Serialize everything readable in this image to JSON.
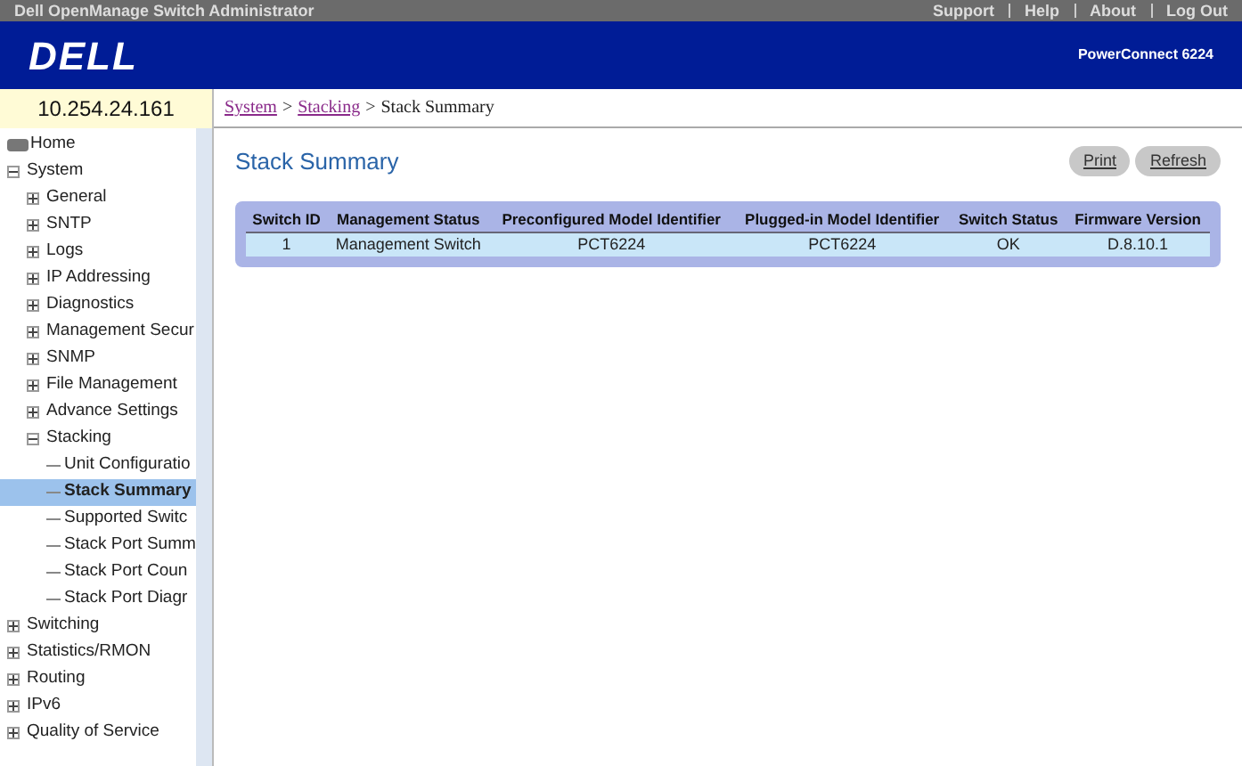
{
  "top_bar": {
    "title": "Dell OpenManage Switch Administrator",
    "links": [
      "Support",
      "Help",
      "About",
      "Log Out"
    ]
  },
  "header": {
    "logo": "DELL",
    "product": "PowerConnect 6224"
  },
  "ip_address": "10.254.24.161",
  "breadcrumb": {
    "separator": ">",
    "items": [
      {
        "label": "System",
        "kind": "link"
      },
      {
        "label": "Stacking",
        "kind": "link"
      },
      {
        "label": "Stack Summary",
        "kind": "current"
      }
    ]
  },
  "sidebar": {
    "items": [
      {
        "label": "Home",
        "kind": "home",
        "selected": false
      },
      {
        "label": "System",
        "kind": "folder",
        "expanded": true,
        "selected": false,
        "children": [
          {
            "label": "General",
            "kind": "folder",
            "expanded": false,
            "selected": false
          },
          {
            "label": "SNTP",
            "kind": "folder",
            "expanded": false,
            "selected": false
          },
          {
            "label": "Logs",
            "kind": "folder",
            "expanded": false,
            "selected": false
          },
          {
            "label": "IP Addressing",
            "kind": "folder",
            "expanded": false,
            "selected": false
          },
          {
            "label": "Diagnostics",
            "kind": "folder",
            "expanded": false,
            "selected": false
          },
          {
            "label": "Management Secur",
            "kind": "folder",
            "expanded": false,
            "selected": false
          },
          {
            "label": "SNMP",
            "kind": "folder",
            "expanded": false,
            "selected": false
          },
          {
            "label": "File Management",
            "kind": "folder",
            "expanded": false,
            "selected": false
          },
          {
            "label": "Advance Settings",
            "kind": "folder",
            "expanded": false,
            "selected": false
          },
          {
            "label": "Stacking",
            "kind": "folder",
            "expanded": true,
            "selected": false,
            "children": [
              {
                "label": "Unit Configuratio",
                "kind": "leaf",
                "selected": false
              },
              {
                "label": "Stack Summary",
                "kind": "leaf",
                "selected": true
              },
              {
                "label": "Supported Switc",
                "kind": "leaf",
                "selected": false
              },
              {
                "label": "Stack Port Summ",
                "kind": "leaf",
                "selected": false
              },
              {
                "label": "Stack Port Coun",
                "kind": "leaf",
                "selected": false
              },
              {
                "label": "Stack Port Diagr",
                "kind": "leaf",
                "selected": false
              }
            ]
          }
        ]
      },
      {
        "label": "Switching",
        "kind": "folder",
        "expanded": false,
        "selected": false
      },
      {
        "label": "Statistics/RMON",
        "kind": "folder",
        "expanded": false,
        "selected": false
      },
      {
        "label": "Routing",
        "kind": "folder",
        "expanded": false,
        "selected": false
      },
      {
        "label": "IPv6",
        "kind": "folder",
        "expanded": false,
        "selected": false
      },
      {
        "label": "Quality of Service",
        "kind": "folder",
        "expanded": false,
        "selected": false
      }
    ]
  },
  "page": {
    "title": "Stack Summary",
    "buttons": [
      "Print",
      "Refresh"
    ],
    "table": {
      "columns": [
        "Switch ID",
        "Management Status",
        "Preconfigured Model Identifier",
        "Plugged-in Model Identifier",
        "Switch Status",
        "Firmware Version"
      ],
      "rows": [
        [
          "1",
          "Management Switch",
          "PCT6224",
          "PCT6224",
          "OK",
          "D.8.10.1"
        ]
      ]
    }
  }
}
